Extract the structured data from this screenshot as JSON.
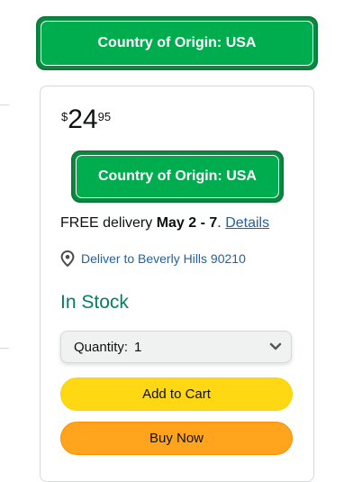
{
  "origin_banner_top": {
    "label": "Country of Origin: USA"
  },
  "buy_box": {
    "price": {
      "symbol": "$",
      "whole": "24",
      "fraction": "95"
    },
    "origin_banner": {
      "label": "Country of Origin: USA"
    },
    "delivery": {
      "prefix": "FREE delivery ",
      "dates": "May 2 - 7",
      "separator": ". ",
      "details_link": "Details"
    },
    "location": {
      "icon": "location-pin-icon",
      "text": "Deliver to Beverly Hills 90210"
    },
    "stock_status": "In Stock",
    "quantity": {
      "label": "Quantity:",
      "value": "1",
      "icon": "chevron-down-icon"
    },
    "add_to_cart_label": "Add to Cart",
    "buy_now_label": "Buy Now"
  },
  "colors": {
    "origin_green": "#00ad4e",
    "stock_green": "#067d62",
    "link_blue": "#2162a1",
    "cart_yellow": "#ffd814",
    "buy_orange": "#ffa41c"
  }
}
